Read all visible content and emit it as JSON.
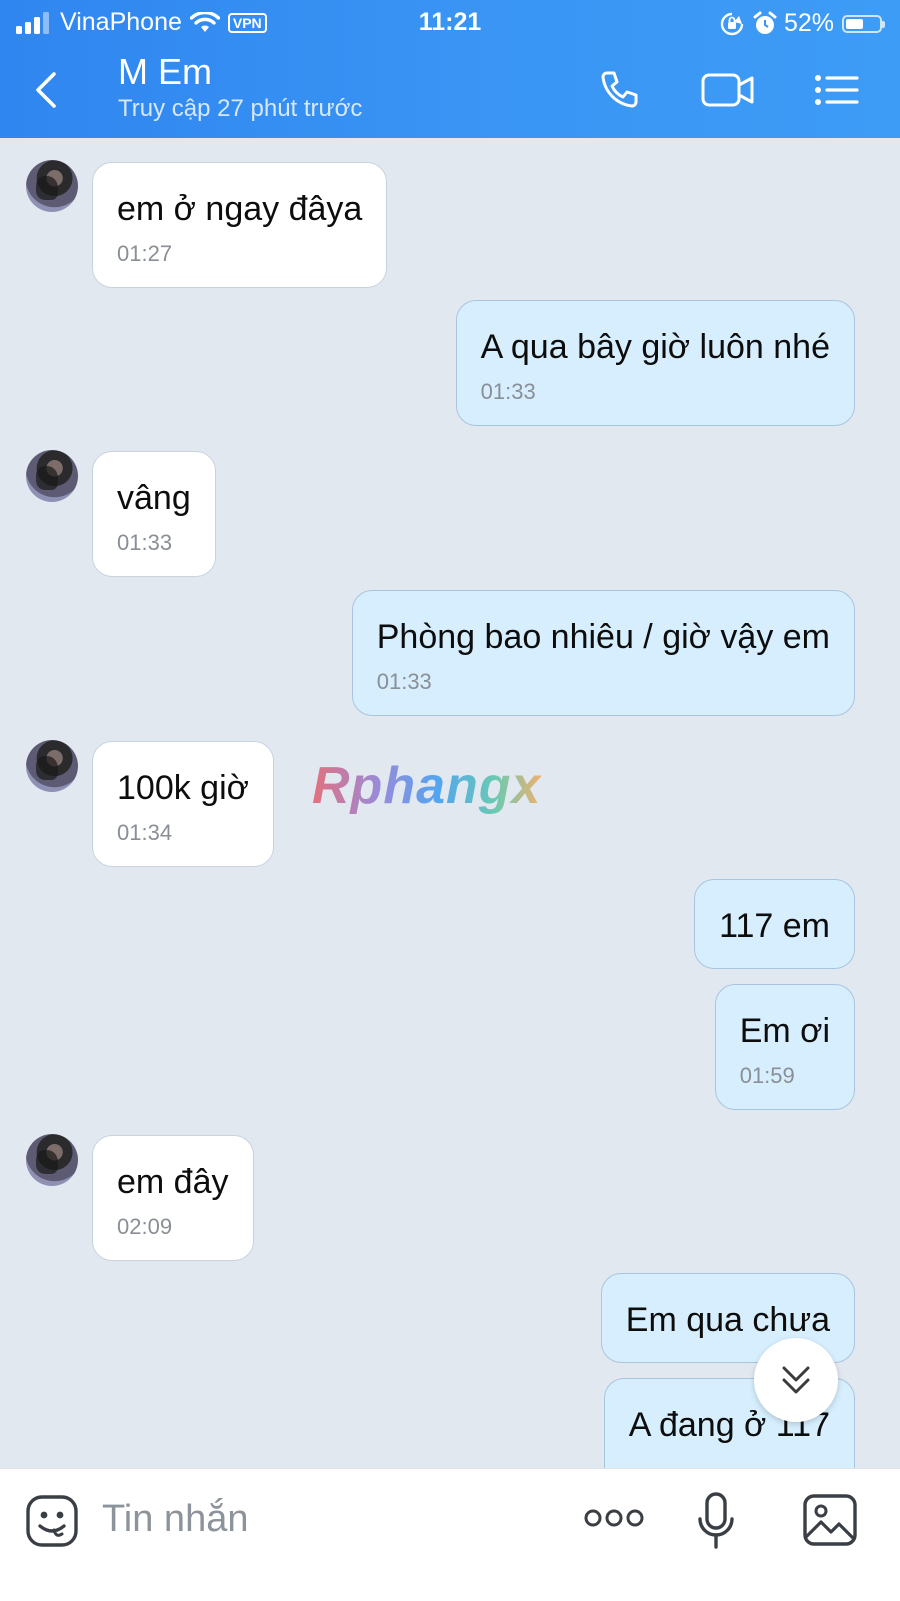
{
  "status_bar": {
    "carrier": "VinaPhone",
    "vpn": "VPN",
    "time": "11:21",
    "battery": "52%",
    "battery_level": 0.52
  },
  "header": {
    "title": "M Em",
    "subtitle": "Truy cập 27 phút trước",
    "icons": [
      "back-icon",
      "phone-icon",
      "video-call-icon",
      "menu-list-icon"
    ]
  },
  "messages": [
    {
      "side": "in",
      "text": "em ở ngay đâya",
      "time": "01:27",
      "avatar": true
    },
    {
      "side": "out",
      "text": "A qua bây giờ luôn nhé",
      "time": "01:33"
    },
    {
      "side": "in",
      "text": "vâng",
      "time": "01:33",
      "avatar": true
    },
    {
      "side": "out",
      "text": "Phòng bao nhiêu / giờ vậy em",
      "time": "01:33"
    },
    {
      "side": "in",
      "text": "100k giờ",
      "time": "01:34",
      "avatar": true
    },
    {
      "side": "out",
      "text": "117 em",
      "time": ""
    },
    {
      "side": "out",
      "text": "Em ơi",
      "time": "01:59"
    },
    {
      "side": "in",
      "text": "em đây",
      "time": "02:09",
      "avatar": true
    },
    {
      "side": "out",
      "text": "Em qua chưa",
      "time": ""
    },
    {
      "side": "out",
      "text": "A đang ở 117",
      "time": ""
    }
  ],
  "watermark": "Rphangx",
  "composer": {
    "placeholder": "Tin nhắn",
    "icons": [
      "sticker-icon",
      "more-dots-icon",
      "microphone-icon",
      "image-icon"
    ]
  },
  "colors": {
    "header": "#3a92f3",
    "chat_background": "#e2e8f0",
    "incoming_bubble": "#ffffff",
    "outgoing_bubble": "#d6eefd"
  }
}
